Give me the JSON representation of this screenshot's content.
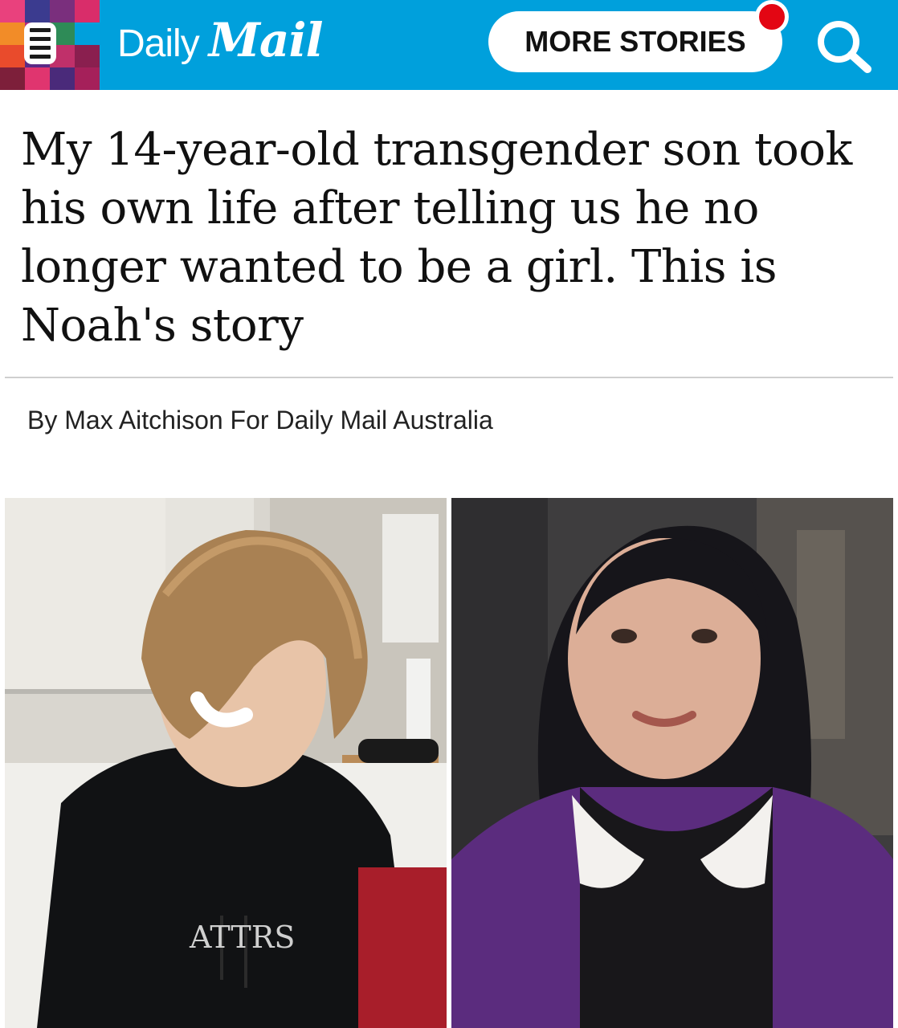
{
  "header": {
    "brand_daily": "Daily",
    "brand_mail": "Mail",
    "more_stories_label": "MORE STORIES",
    "brand_color": "#00a0dc",
    "icons": [
      "menu-icon",
      "search-icon",
      "notification-dot"
    ]
  },
  "article": {
    "headline": "My 14-year-old transgender son took his own life after telling us he no longer wanted to be a girl. This is Noah's story",
    "byline": "By Max Aitchison For Daily Mail Australia",
    "images": [
      {
        "name": "noah-hospital-photo"
      },
      {
        "name": "mother-interview-photo"
      }
    ]
  }
}
